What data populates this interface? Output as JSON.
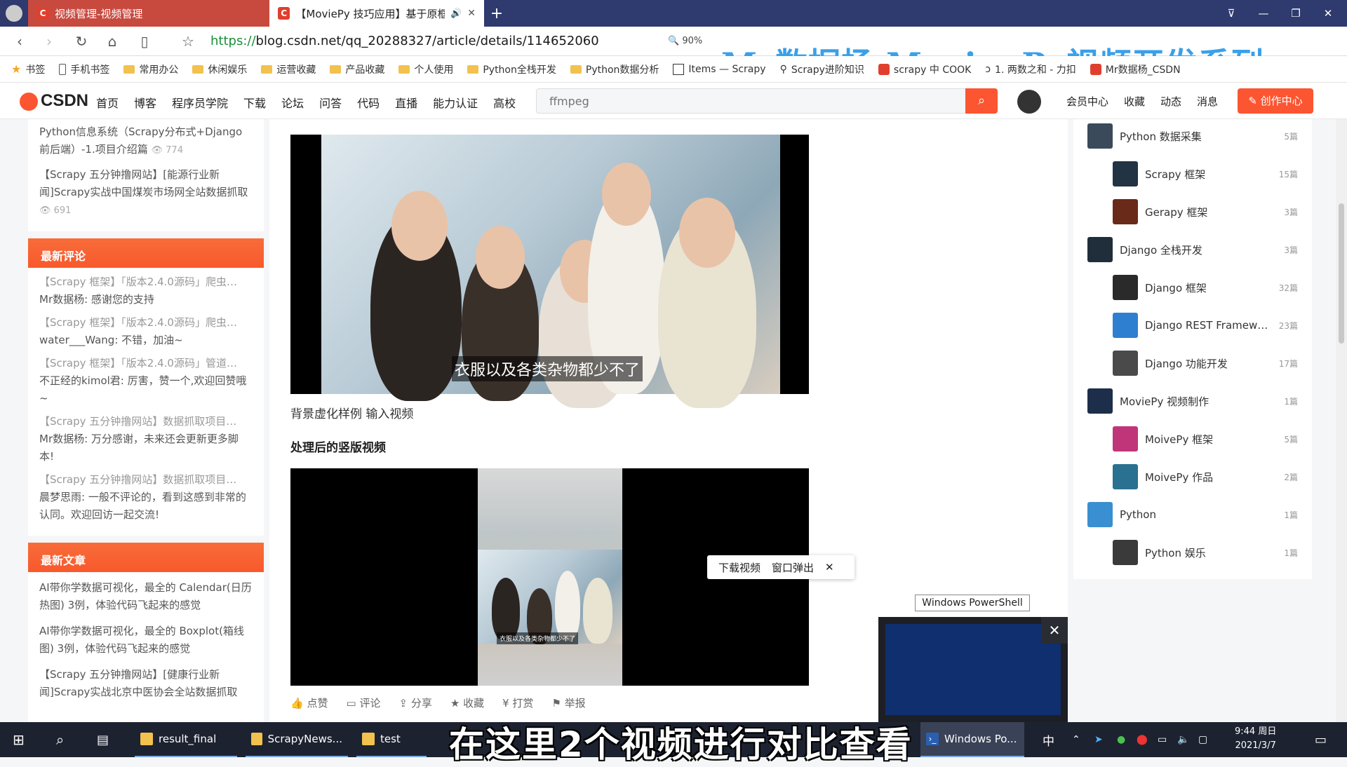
{
  "tabs": [
    {
      "label": "视频管理-视频管理"
    },
    {
      "label": "【MoviePy 技巧应用】基于原框"
    }
  ],
  "address": {
    "url_scheme": "https://",
    "url_rest": "blog.csdn.net/qq_20288327/article/details/114652060",
    "zoom": "90%"
  },
  "overlay_title": "Mr数据杨 MovipePy视频开发系列",
  "bookmarks": [
    "书签",
    "手机书签",
    "常用办公",
    "休闲娱乐",
    "运营收藏",
    "产品收藏",
    "个人使用",
    "Python全栈开发",
    "Python数据分析",
    "Items — Scrapy",
    "Scrapy进阶知识",
    "scrapy 中 COOK",
    "1. 两数之和 - 力扣",
    "Mr数据杨_CSDN"
  ],
  "csdn": {
    "logo": "CSDN",
    "nav": [
      "首页",
      "博客",
      "程序员学院",
      "下载",
      "论坛",
      "问答",
      "代码",
      "直播",
      "能力认证",
      "高校"
    ],
    "search_placeholder": "ffmpeg",
    "right_nav": [
      "会员中心",
      "收藏",
      "动态",
      "消息"
    ],
    "create_label": "创作中心"
  },
  "left": {
    "top_items": [
      {
        "title": "Python信息系统（Scrapy分布式+Django前后端）-1.项目介绍篇",
        "views": "774"
      },
      {
        "title": "【Scrapy 五分钟撸网站】[能源行业新闻]Scrapy实战中国煤炭市场网全站数据抓取",
        "views": "691"
      }
    ],
    "comments_title": "最新评论",
    "comments": [
      {
        "title": "【Scrapy 框架】「版本2.4.0源码」爬虫…",
        "text": "Mr数据杨: 感谢您的支持"
      },
      {
        "title": "【Scrapy 框架】「版本2.4.0源码」爬虫…",
        "text": "water___Wang: 不错，加油~"
      },
      {
        "title": "【Scrapy 框架】「版本2.4.0源码」管道…",
        "text": "不正经的kimol君: 厉害，赞一个,欢迎回赞哦~"
      },
      {
        "title": "【Scrapy 五分钟撸网站】数据抓取项目…",
        "text": "Mr数据杨: 万分感谢，未来还会更新更多脚本!"
      },
      {
        "title": "【Scrapy 五分钟撸网站】数据抓取项目…",
        "text": "晨梦思雨: 一般不评论的，看到这感到非常的认同。欢迎回访一起交流!"
      }
    ],
    "articles_title": "最新文章",
    "articles": [
      "AI带你学数据可视化，最全的 Calendar(日历热图) 3例，体验代码飞起来的感觉",
      "AI带你学数据可视化，最全的 Boxplot(箱线图) 3例，体验代码飞起来的感觉",
      "【Scrapy 五分钟撸网站】[健康行业新闻]Scrapy实战北京中医协会全站数据抓取"
    ]
  },
  "article": {
    "video1_subtitle": "衣服以及各类杂物都少不了",
    "caption1": "背景虚化样例 输入视频",
    "caption2": "处理后的竖版视频",
    "video2_subtitle": "衣服以及各类杂物都少不了",
    "popup": {
      "download": "下载视频",
      "popout": "窗口弹出"
    },
    "actions": [
      "点赞",
      "评论",
      "分享",
      "收藏",
      "打赏",
      "举报"
    ]
  },
  "categories": [
    {
      "name": "Python 数据采集",
      "count": "5篇",
      "sub": false,
      "color": "#3a4a5a"
    },
    {
      "name": "Scrapy 框架",
      "count": "15篇",
      "sub": true,
      "color": "#223344"
    },
    {
      "name": "Gerapy 框架",
      "count": "3篇",
      "sub": true,
      "color": "#6a2a1a"
    },
    {
      "name": "Django 全栈开发",
      "count": "3篇",
      "sub": false,
      "color": "#1f2e3a"
    },
    {
      "name": "Django 框架",
      "count": "32篇",
      "sub": true,
      "color": "#2a2a2a"
    },
    {
      "name": "Django REST Framew…",
      "count": "23篇",
      "sub": true,
      "color": "#2f7fd0"
    },
    {
      "name": "Django 功能开发",
      "count": "17篇",
      "sub": true,
      "color": "#4a4a4a"
    },
    {
      "name": "MoviePy 视频制作",
      "count": "1篇",
      "sub": false,
      "color": "#1c2e4a"
    },
    {
      "name": "MoivePy 框架",
      "count": "5篇",
      "sub": true,
      "color": "#c0357a"
    },
    {
      "name": "MoivePy 作品",
      "count": "2篇",
      "sub": true,
      "color": "#2a7090"
    },
    {
      "name": "Python",
      "count": "1篇",
      "sub": false,
      "color": "#3a8fd0"
    },
    {
      "name": "Python 娱乐",
      "count": "1篇",
      "sub": true,
      "color": "#3a3a3a"
    }
  ],
  "powershell": {
    "label": "Windows PowerShell"
  },
  "taskbar": {
    "items": [
      "result_final",
      "ScrapyNews...",
      "test",
      "Windows Po..."
    ],
    "subtitle": "在这里2个视频进行对比查看",
    "time": "9:44 周日",
    "date": "2021/3/7",
    "ime": "中"
  }
}
